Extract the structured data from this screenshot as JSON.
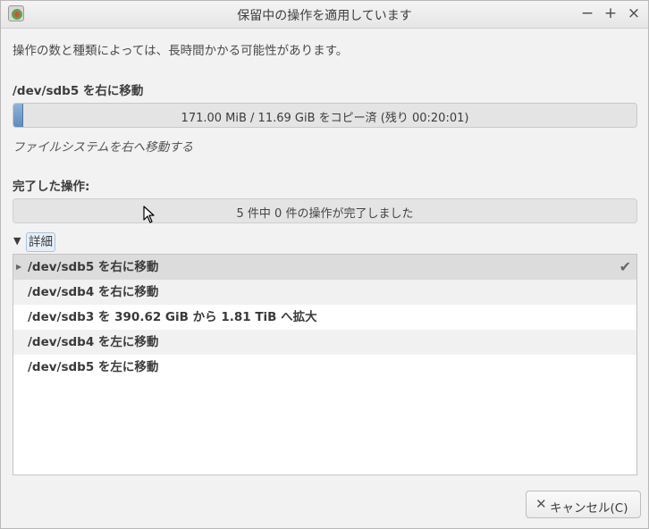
{
  "window": {
    "title": "保留中の操作を適用しています",
    "controls": {
      "minimize": "−",
      "maximize": "+",
      "close": "×"
    },
    "app_icon": "gparted-icon"
  },
  "info_text": "操作の数と種類によっては、長時間かかる可能性があります。",
  "current_operation": {
    "title": "/dev/sdb5 を右に移動",
    "progress_fraction": 0.0143,
    "progress_text": "171.00 MiB / 11.69 GiB をコピー済 (残り 00:20:01)",
    "sub_status": "ファイルシステムを右へ移動する"
  },
  "completed": {
    "title": "完了した操作:",
    "progress_text": "5 件中 0 件の操作が完了しました"
  },
  "details": {
    "label": "詳細",
    "expanded": true,
    "operations": [
      {
        "label": "/dev/sdb5 を右に移動",
        "state": "active"
      },
      {
        "label": "/dev/sdb4 を右に移動",
        "state": "pending"
      },
      {
        "label": "/dev/sdb3 を 390.62 GiB から 1.81 TiB へ拡大",
        "state": "pending"
      },
      {
        "label": "/dev/sdb4 を左に移動",
        "state": "pending"
      },
      {
        "label": "/dev/sdb5 を左に移動",
        "state": "pending"
      }
    ]
  },
  "cancel_button": {
    "label": "キャンセル(C)",
    "icon": "close-icon"
  },
  "colors": {
    "progress_fill": "#5d8dbd",
    "selected_row": "#dcdcdc"
  }
}
